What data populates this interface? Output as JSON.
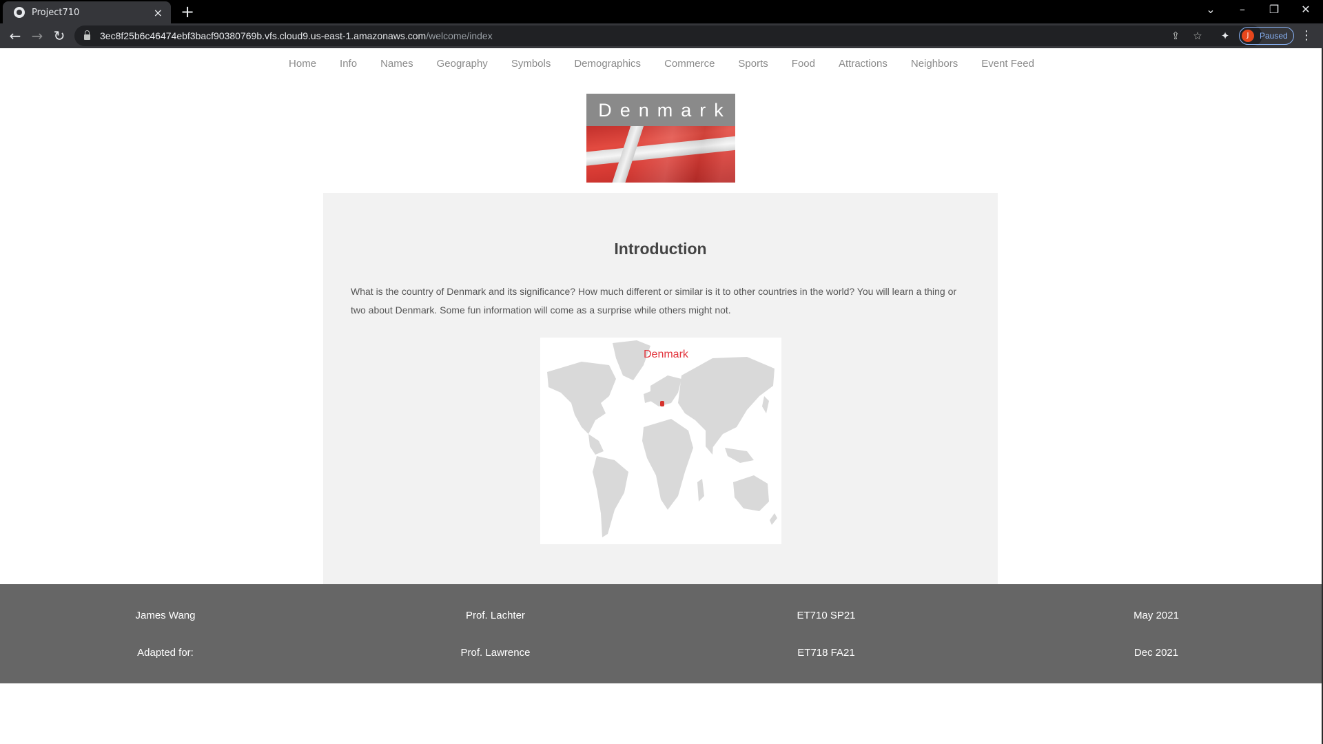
{
  "browser": {
    "tab_title": "Project710",
    "tab_close": "×",
    "new_tab": "+",
    "url_host": "3ec8f25b6c46474ebf3bacf90380769b.vfs.cloud9.us-east-1.amazonaws.com",
    "url_path": "/welcome/index",
    "profile_initial": "J",
    "profile_status": "Paused"
  },
  "nav": {
    "items": [
      "Home",
      "Info",
      "Names",
      "Geography",
      "Symbols",
      "Demographics",
      "Commerce",
      "Sports",
      "Food",
      "Attractions",
      "Neighbors",
      "Event Feed"
    ]
  },
  "banner": {
    "title": "Denmark"
  },
  "intro": {
    "title": "Introduction",
    "text": "What is the country of Denmark and its significance? How much different or similar is it to other countries in the world? You will learn a thing or two about Denmark. Some fun information will come as a surprise while others might not.",
    "map_label": "Denmark"
  },
  "footer": {
    "row1": [
      "James Wang",
      "Prof. Lachter",
      "ET710 SP21",
      "May 2021"
    ],
    "row2": [
      "Adapted for:",
      "Prof. Lawrence",
      "ET718 FA21",
      "Dec 2021"
    ]
  },
  "colors": {
    "chrome_bg": "#000000",
    "toolbar_bg": "#35363a",
    "content_bg": "#f2f2f2",
    "footer_bg": "#666666",
    "accent_red": "#d6332d"
  }
}
